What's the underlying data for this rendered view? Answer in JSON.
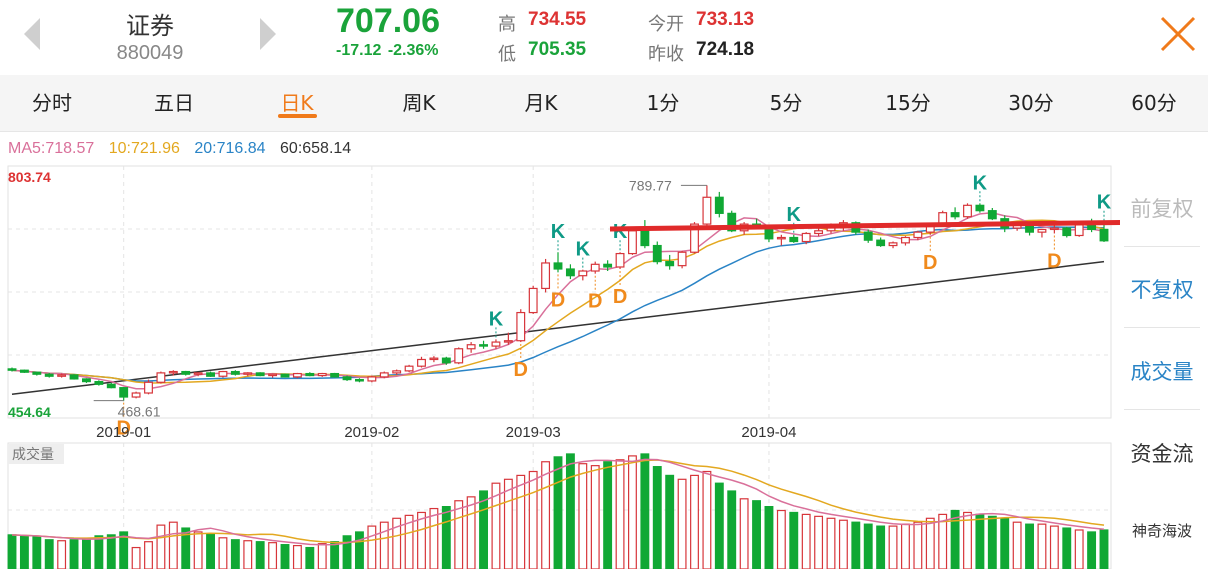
{
  "header": {
    "name": "证券",
    "code": "880049",
    "price": "707.06",
    "change": "-17.12",
    "change_pct": "-2.36%",
    "high_label": "高",
    "high": "734.55",
    "low_label": "低",
    "low": "705.35",
    "open_label": "今开",
    "open": "733.13",
    "prev_close_label": "昨收",
    "prev_close": "724.18"
  },
  "tabs": [
    "分时",
    "五日",
    "日K",
    "周K",
    "月K",
    "1分",
    "5分",
    "15分",
    "30分",
    "60分"
  ],
  "active_tab": "日K",
  "ma_legend": {
    "ma5": "MA5:718.57",
    "ma10": "10:721.96",
    "ma20": "20:716.84",
    "ma60": "60:658.14"
  },
  "side_panel": {
    "adjust_front": "前复权",
    "adjust_none": "不复权",
    "volume": "成交量",
    "capital_flow": "资金流",
    "indicator": "神奇海波"
  },
  "colors": {
    "up": "#d7353a",
    "down": "#10a834",
    "ma5": "#d9709a",
    "ma10": "#e3a820",
    "ma20": "#2a84c6",
    "ma60": "#333333",
    "anno_k": "#0f9a86",
    "anno_d": "#f08a1c",
    "arrow": "#e02a2a",
    "accent": "#f07a1a"
  },
  "chart_data": {
    "type": "candlestick",
    "title": "",
    "y_max_label": "803.74",
    "y_min_label": "454.64",
    "ylim": [
      454.64,
      803.74
    ],
    "high_annotation": "789.77",
    "low_annotation": "468.61",
    "x_tick_labels": [
      "2019-01",
      "2019-02",
      "2019-03",
      "2019-04"
    ],
    "x_tick_index": [
      9,
      29,
      42,
      61
    ],
    "volume_label": "成交量",
    "candles": [
      [
        516,
        518,
        512,
        514
      ],
      [
        514,
        515,
        510,
        511
      ],
      [
        511,
        512,
        506,
        508
      ],
      [
        508,
        510,
        503,
        505
      ],
      [
        505,
        509,
        503,
        507
      ],
      [
        507,
        508,
        500,
        501
      ],
      [
        501,
        502,
        495,
        497
      ],
      [
        497,
        499,
        491,
        493
      ],
      [
        493,
        495,
        487,
        488
      ],
      [
        488,
        489,
        468.61,
        474
      ],
      [
        474,
        482,
        472,
        480
      ],
      [
        480,
        500,
        478,
        496
      ],
      [
        496,
        512,
        494,
        510
      ],
      [
        510,
        514,
        506,
        512
      ],
      [
        512,
        513,
        506,
        508
      ],
      [
        508,
        511,
        505,
        510
      ],
      [
        510,
        512,
        504,
        505
      ],
      [
        505,
        513,
        503,
        512
      ],
      [
        512,
        514,
        506,
        508
      ],
      [
        508,
        511,
        505,
        510
      ],
      [
        510,
        511,
        505,
        506
      ],
      [
        506,
        509,
        503,
        508
      ],
      [
        508,
        509,
        503,
        504
      ],
      [
        504,
        510,
        502,
        509
      ],
      [
        509,
        511,
        505,
        506
      ],
      [
        506,
        510,
        504,
        509
      ],
      [
        509,
        510,
        503,
        504
      ],
      [
        504,
        506,
        498,
        500
      ],
      [
        500,
        502,
        496,
        498
      ],
      [
        498,
        506,
        496,
        504
      ],
      [
        504,
        512,
        502,
        510
      ],
      [
        510,
        515,
        507,
        513
      ],
      [
        513,
        522,
        511,
        520
      ],
      [
        520,
        534,
        518,
        530
      ],
      [
        530,
        535,
        526,
        532
      ],
      [
        532,
        534,
        522,
        525
      ],
      [
        525,
        548,
        523,
        546
      ],
      [
        546,
        556,
        540,
        552
      ],
      [
        552,
        558,
        546,
        550
      ],
      [
        550,
        560,
        546,
        556
      ],
      [
        556,
        570,
        552,
        558
      ],
      [
        558,
        605,
        556,
        600
      ],
      [
        600,
        640,
        598,
        636
      ],
      [
        636,
        680,
        630,
        674
      ],
      [
        674,
        690,
        660,
        665
      ],
      [
        665,
        672,
        650,
        655
      ],
      [
        655,
        664,
        648,
        662
      ],
      [
        662,
        676,
        658,
        672
      ],
      [
        672,
        678,
        662,
        668
      ],
      [
        668,
        690,
        665,
        688
      ],
      [
        688,
        726,
        686,
        722
      ],
      [
        722,
        738,
        696,
        700
      ],
      [
        700,
        706,
        672,
        676
      ],
      [
        676,
        686,
        664,
        670
      ],
      [
        670,
        692,
        666,
        690
      ],
      [
        690,
        735,
        688,
        732
      ],
      [
        732,
        789.77,
        730,
        772
      ],
      [
        772,
        780,
        742,
        748
      ],
      [
        748,
        752,
        720,
        722
      ],
      [
        722,
        735,
        716,
        732
      ],
      [
        732,
        740,
        724,
        726
      ],
      [
        726,
        728,
        705,
        710
      ],
      [
        710,
        716,
        700,
        712
      ],
      [
        712,
        716,
        704,
        706
      ],
      [
        706,
        720,
        702,
        718
      ],
      [
        718,
        726,
        714,
        722
      ],
      [
        722,
        733,
        718,
        730
      ],
      [
        730,
        738,
        722,
        734
      ],
      [
        734,
        736,
        716,
        720
      ],
      [
        720,
        724,
        704,
        708
      ],
      [
        708,
        712,
        698,
        700
      ],
      [
        700,
        706,
        696,
        704
      ],
      [
        704,
        714,
        700,
        712
      ],
      [
        712,
        722,
        708,
        720
      ],
      [
        720,
        734,
        716,
        732
      ],
      [
        732,
        752,
        728,
        749
      ],
      [
        749,
        757,
        739,
        743
      ],
      [
        743,
        763,
        740,
        760
      ],
      [
        760,
        763,
        749,
        752
      ],
      [
        752,
        756,
        738,
        740
      ],
      [
        740,
        745,
        720,
        726
      ],
      [
        726,
        733,
        722,
        731
      ],
      [
        731,
        735,
        715,
        720
      ],
      [
        720,
        725,
        712,
        724
      ],
      [
        724,
        734,
        718,
        726
      ],
      [
        726,
        728,
        712,
        715
      ],
      [
        715,
        736,
        713,
        734
      ],
      [
        734,
        740,
        720,
        724
      ],
      [
        724,
        734,
        705.35,
        707.06
      ]
    ],
    "volume": [
      35,
      34,
      33,
      30,
      29,
      30,
      31,
      34,
      35,
      38,
      22,
      28,
      45,
      48,
      42,
      38,
      36,
      32,
      30,
      29,
      28,
      27,
      25,
      24,
      22,
      26,
      28,
      34,
      38,
      44,
      48,
      52,
      55,
      58,
      62,
      64,
      70,
      74,
      80,
      88,
      92,
      96,
      100,
      110,
      115,
      118,
      108,
      106,
      110,
      112,
      116,
      118,
      105,
      96,
      92,
      96,
      100,
      88,
      80,
      72,
      70,
      64,
      60,
      58,
      56,
      54,
      52,
      50,
      48,
      46,
      44,
      44,
      46,
      48,
      52,
      56,
      60,
      58,
      56,
      54,
      52,
      48,
      46,
      46,
      44,
      42,
      40,
      38,
      40
    ],
    "volume_ylim": [
      0,
      120
    ],
    "marker_K_index": [
      39,
      44,
      46,
      49,
      63,
      78,
      88
    ],
    "marker_D_index": [
      9,
      41,
      44,
      47,
      49,
      74,
      84
    ],
    "annotation_K": "K",
    "annotation_D": "D"
  }
}
